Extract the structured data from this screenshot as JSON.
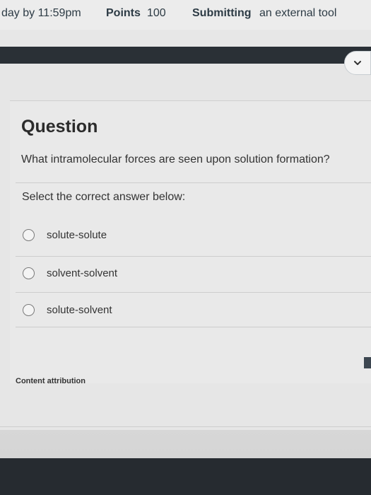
{
  "details": {
    "due_text": "day by 11:59pm",
    "points_label": "Points",
    "points_value": "100",
    "submitting_label": "Submitting",
    "submitting_value": "an external tool"
  },
  "nav": {
    "next_icon": "chevron-right-icon"
  },
  "question": {
    "heading": "Question",
    "text": "What intramolecular forces are seen upon solution formation?",
    "instruction": "Select the correct answer below:",
    "options": [
      {
        "label": "solute-solute",
        "selected": false
      },
      {
        "label": "solvent-solvent",
        "selected": false
      },
      {
        "label": "solute-solvent",
        "selected": false
      }
    ],
    "attribution": "Content attribution"
  }
}
